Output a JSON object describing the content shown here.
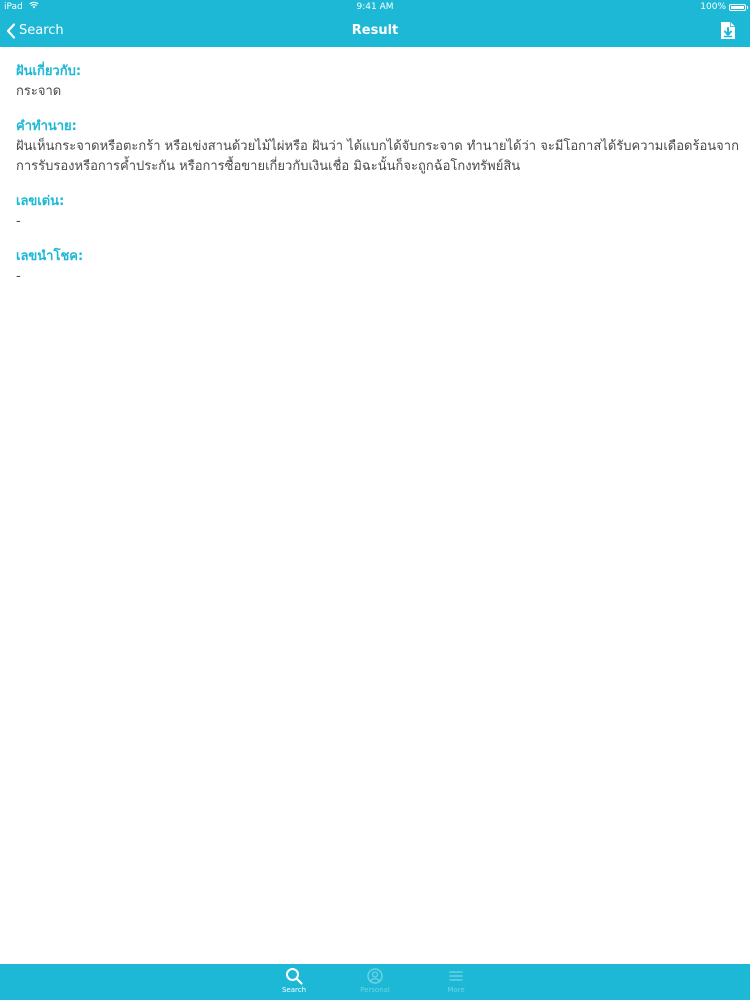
{
  "status_bar": {
    "device": "iPad",
    "time": "9:41 AM",
    "battery": "100%"
  },
  "nav": {
    "back_label": "Search",
    "title": "Result",
    "action_icon": "download-document-icon"
  },
  "sections": [
    {
      "label": "ฝันเกี่ยวกับ:",
      "value": "กระจาด"
    },
    {
      "label": "คำทำนาย:",
      "value": "ฝันเห็นกระจาดหรือตะกร้า หรือเข่งสานด้วยไม้ไผ่หรือ ฝันว่า ได้แบกได้จับกระจาด ทำนายได้ว่า จะมีโอกาสได้รับความเดือดร้อนจากการรับรองหรือการค้ำประกัน หรือการซื้อขายเกี่ยวกับเงินเชื่อ มิฉะนั้นก็จะถูกฉ้อโกงทรัพย์สิน"
    },
    {
      "label": "เลขเด่น:",
      "value": "-"
    },
    {
      "label": "เลขนำโชค:",
      "value": "-"
    }
  ],
  "tab_bar": {
    "tabs": [
      {
        "label": "Search",
        "icon": "search-icon",
        "active": true
      },
      {
        "label": "Personal",
        "icon": "personal-icon",
        "active": false
      },
      {
        "label": "More",
        "icon": "more-icon",
        "active": false
      }
    ]
  },
  "colors": {
    "accent": "#1cb8d6",
    "body_text": "#4a4a4a",
    "background": "#ffffff"
  }
}
